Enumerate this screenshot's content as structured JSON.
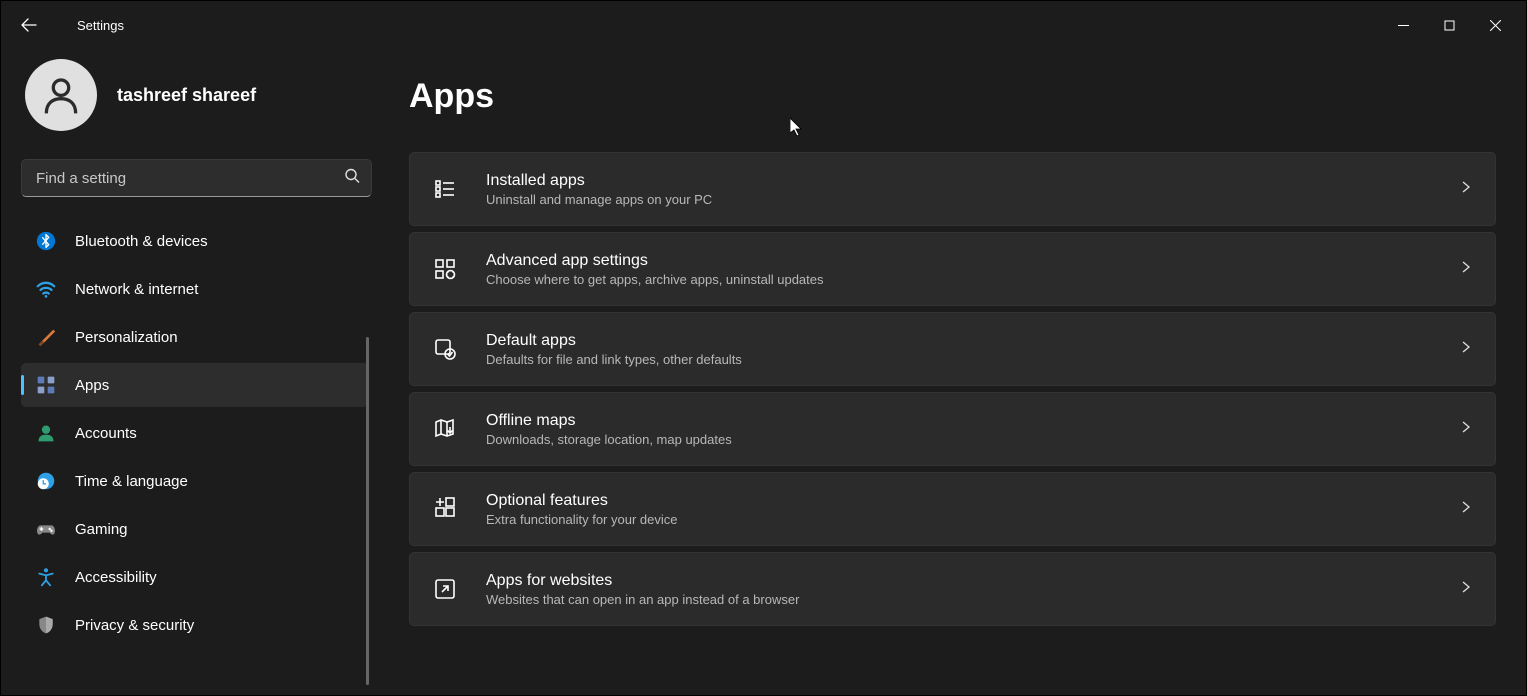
{
  "window": {
    "title": "Settings"
  },
  "profile": {
    "username": "tashreef shareef"
  },
  "search": {
    "placeholder": "Find a setting"
  },
  "sidebar": {
    "items": [
      {
        "label": "Bluetooth & devices"
      },
      {
        "label": "Network & internet"
      },
      {
        "label": "Personalization"
      },
      {
        "label": "Apps"
      },
      {
        "label": "Accounts"
      },
      {
        "label": "Time & language"
      },
      {
        "label": "Gaming"
      },
      {
        "label": "Accessibility"
      },
      {
        "label": "Privacy & security"
      }
    ]
  },
  "page": {
    "title": "Apps"
  },
  "cards": [
    {
      "title": "Installed apps",
      "sub": "Uninstall and manage apps on your PC"
    },
    {
      "title": "Advanced app settings",
      "sub": "Choose where to get apps, archive apps, uninstall updates"
    },
    {
      "title": "Default apps",
      "sub": "Defaults for file and link types, other defaults"
    },
    {
      "title": "Offline maps",
      "sub": "Downloads, storage location, map updates"
    },
    {
      "title": "Optional features",
      "sub": "Extra functionality for your device"
    },
    {
      "title": "Apps for websites",
      "sub": "Websites that can open in an app instead of a browser"
    }
  ]
}
